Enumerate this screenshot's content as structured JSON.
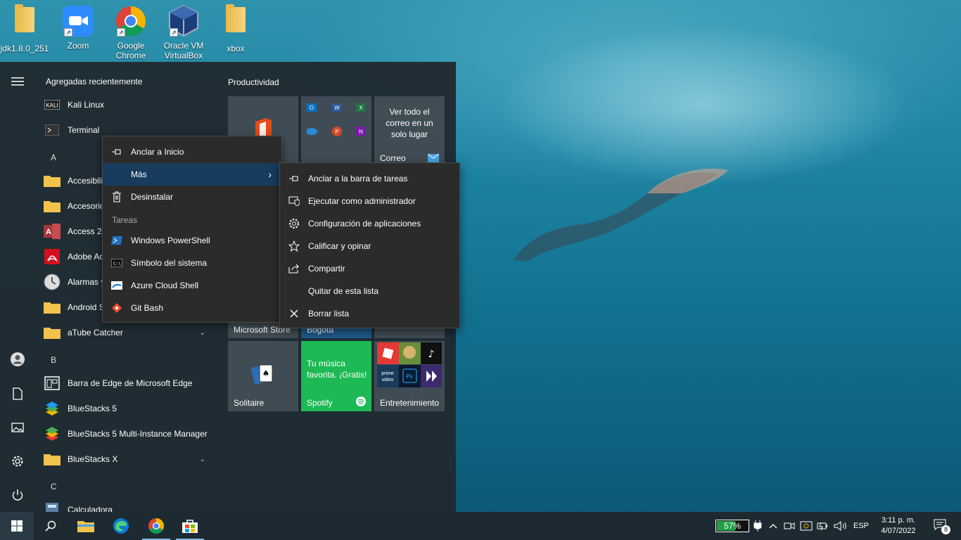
{
  "desktop": {
    "icons": [
      {
        "label": "jdk1.8.0_251",
        "kind": "folder"
      },
      {
        "label": "Zoom",
        "kind": "zoom"
      },
      {
        "label": "Google Chrome",
        "kind": "chrome"
      },
      {
        "label": "Oracle VM VirtualBox",
        "kind": "virtualbox"
      },
      {
        "label": "xbox",
        "kind": "folder"
      }
    ]
  },
  "start": {
    "recent_header": "Agregadas recientemente",
    "apps": [
      {
        "label": "Kali Linux",
        "icon": "kali-icon"
      },
      {
        "label": "Terminal",
        "icon": "terminal-icon"
      },
      {
        "letter": "A"
      },
      {
        "label": "Accesibilidad",
        "icon": "folder-icon",
        "expandable": true
      },
      {
        "label": "Accesorios de Windows",
        "icon": "folder-icon",
        "expandable": true
      },
      {
        "label": "Access 2016",
        "icon": "access-icon"
      },
      {
        "label": "Adobe Acrobat DC",
        "icon": "acrobat-icon"
      },
      {
        "label": "Alarmas y reloj",
        "icon": "clock-icon"
      },
      {
        "label": "Android Studio",
        "icon": "folder-icon",
        "expandable": true
      },
      {
        "label": "aTube Catcher",
        "icon": "folder-icon",
        "expandable": true
      },
      {
        "letter": "B"
      },
      {
        "label": "Barra de Edge de Microsoft Edge",
        "icon": "edge-bar-icon"
      },
      {
        "label": "BlueStacks 5",
        "icon": "bluestacks-icon"
      },
      {
        "label": "BlueStacks 5 Multi-Instance Manager",
        "icon": "bluestacks-multi-icon"
      },
      {
        "label": "BlueStacks X",
        "icon": "folder-icon",
        "expandable": true
      },
      {
        "letter": "C"
      },
      {
        "label": "Calculadora",
        "icon": "calculator-icon"
      }
    ],
    "tiles_header": "Productividad",
    "tiles": {
      "office": {
        "label": ""
      },
      "mail": {
        "text": "Ver todo el correo en un solo lugar",
        "label": "Correo"
      },
      "store": {
        "label": "Microsoft Store"
      },
      "weather": {
        "label": "Bogotá"
      },
      "solitaire": {
        "label": "Solitaire"
      },
      "spotify": {
        "text": "Tu música favorita. ¡Gratis!",
        "label": "Spotify"
      },
      "entertainment": {
        "label": "Entretenimiento"
      }
    },
    "rail": [
      "hamburger-icon",
      "user-icon",
      "documents-icon",
      "pictures-icon",
      "settings-icon",
      "power-icon"
    ]
  },
  "context_menu": {
    "items": [
      "Anclar a Inicio",
      "Más",
      "Desinstalar"
    ],
    "tasks_header": "Tareas",
    "tasks": [
      "Windows PowerShell",
      "Símbolo del sistema",
      "Azure Cloud Shell",
      "Git Bash"
    ]
  },
  "submenu": {
    "items": [
      "Anclar a la barra de tareas",
      "Ejecutar como administrador",
      "Configuración de aplicaciones",
      "Calificar y opinar",
      "Compartir",
      "Quitar de esta lista",
      "Borrar lista"
    ]
  },
  "taskbar": {
    "battery": "57%",
    "battery_level": 0.57,
    "language": "ESP",
    "time": "3:11 p. m.",
    "date": "4/07/2022",
    "notifications": "8"
  }
}
